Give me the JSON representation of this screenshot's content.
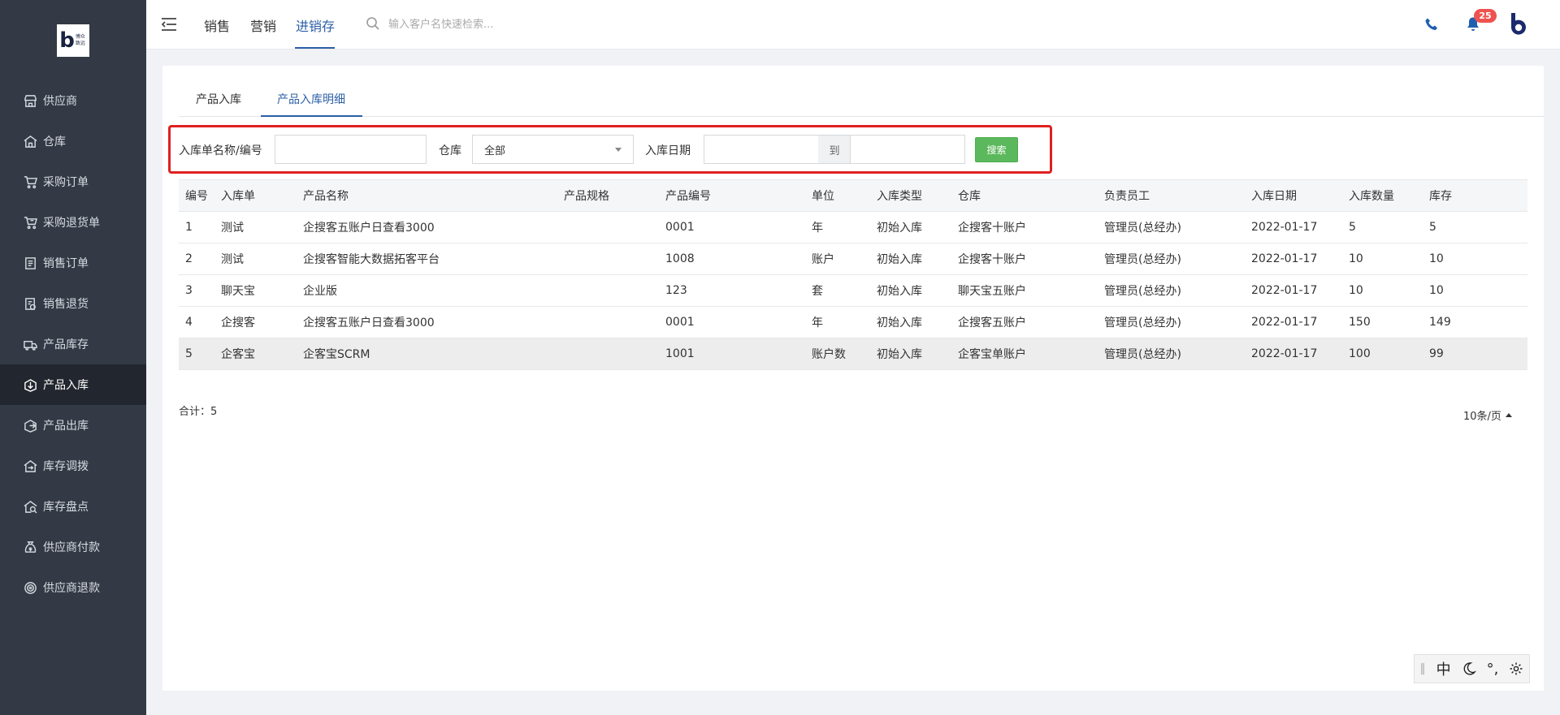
{
  "logo": {
    "text": "博众 致远"
  },
  "sidebar": {
    "items": [
      {
        "label": "供应商",
        "icon": "store-icon"
      },
      {
        "label": "仓库",
        "icon": "warehouse-icon"
      },
      {
        "label": "采购订单",
        "icon": "cart-icon"
      },
      {
        "label": "采购退货单",
        "icon": "cart-return-icon"
      },
      {
        "label": "销售订单",
        "icon": "order-list-icon"
      },
      {
        "label": "销售退货",
        "icon": "sales-return-icon"
      },
      {
        "label": "产品库存",
        "icon": "truck-icon"
      },
      {
        "label": "产品入库",
        "icon": "stock-in-icon",
        "active": true
      },
      {
        "label": "产品出库",
        "icon": "stock-out-icon"
      },
      {
        "label": "库存调拨",
        "icon": "transfer-icon"
      },
      {
        "label": "库存盘点",
        "icon": "inventory-check-icon"
      },
      {
        "label": "供应商付款",
        "icon": "money-bag-icon"
      },
      {
        "label": "供应商退款",
        "icon": "refund-icon"
      }
    ]
  },
  "header": {
    "tabs": [
      {
        "label": "销售"
      },
      {
        "label": "营销"
      },
      {
        "label": "进销存",
        "active": true
      }
    ],
    "search_placeholder": "输入客户名快速检索...",
    "notification_count": "25"
  },
  "page_tabs": [
    {
      "label": "产品入库"
    },
    {
      "label": "产品入库明细",
      "active": true
    }
  ],
  "filters": {
    "name_label": "入库单名称/编号",
    "warehouse_label": "仓库",
    "warehouse_value": "全部",
    "date_label": "入库日期",
    "date_to": "到",
    "search_button": "搜索"
  },
  "table": {
    "headers": [
      "编号",
      "入库单",
      "产品名称",
      "产品规格",
      "产品编号",
      "单位",
      "入库类型",
      "仓库",
      "负责员工",
      "入库日期",
      "入库数量",
      "库存"
    ],
    "rows": [
      [
        "1",
        "测试",
        "企搜客五账户日查看3000",
        "",
        "0001",
        "年",
        "初始入库",
        "企搜客十账户",
        "管理员(总经办)",
        "2022-01-17",
        "5",
        "5"
      ],
      [
        "2",
        "测试",
        "企搜客智能大数据拓客平台",
        "",
        "1008",
        "账户",
        "初始入库",
        "企搜客十账户",
        "管理员(总经办)",
        "2022-01-17",
        "10",
        "10"
      ],
      [
        "3",
        "聊天宝",
        "企业版",
        "",
        "123",
        "套",
        "初始入库",
        "聊天宝五账户",
        "管理员(总经办)",
        "2022-01-17",
        "10",
        "10"
      ],
      [
        "4",
        "企搜客",
        "企搜客五账户日查看3000",
        "",
        "0001",
        "年",
        "初始入库",
        "企搜客五账户",
        "管理员(总经办)",
        "2022-01-17",
        "150",
        "149"
      ],
      [
        "5",
        "企客宝",
        "企客宝SCRM",
        "",
        "1001",
        "账户数",
        "初始入库",
        "企客宝单账户",
        "管理员(总经办)",
        "2022-01-17",
        "100",
        "99"
      ]
    ]
  },
  "footer": {
    "total": "合计：5",
    "page_size": "10条/页"
  },
  "ime": {
    "lang": "中",
    "punct": "°,"
  }
}
